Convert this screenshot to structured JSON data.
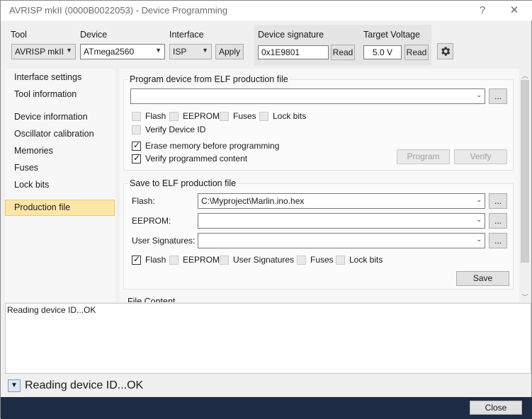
{
  "window": {
    "title": "AVRISP mkII (0000B0022053) - Device Programming",
    "help_glyph": "?",
    "close_glyph": "✕"
  },
  "toolbar": {
    "tool_label": "Tool",
    "tool_value": "AVRISP mkII",
    "device_label": "Device",
    "device_value": "ATmega2560",
    "interface_label": "Interface",
    "interface_value": "ISP",
    "apply_label": "Apply",
    "signature_label": "Device signature",
    "signature_value": "0x1E9801",
    "signature_read_label": "Read",
    "voltage_label": "Target Voltage",
    "voltage_value": "5.0 V",
    "voltage_read_label": "Read",
    "settings_icon": "gear-icon"
  },
  "sidebar": {
    "items": [
      {
        "label": "Interface settings"
      },
      {
        "label": "Tool information"
      },
      {
        "label": "Device information"
      },
      {
        "label": "Oscillator calibration"
      },
      {
        "label": "Memories"
      },
      {
        "label": "Fuses"
      },
      {
        "label": "Lock bits"
      },
      {
        "label": "Production file"
      }
    ],
    "active": "Production file"
  },
  "program_group": {
    "title": "Program device from ELF production file",
    "file_value": "",
    "browse_label": "...",
    "checks": {
      "flash": {
        "label": "Flash",
        "checked": false
      },
      "eeprom": {
        "label": "EEPROM",
        "checked": false
      },
      "fuses": {
        "label": "Fuses",
        "checked": false
      },
      "lockbits": {
        "label": "Lock bits",
        "checked": false
      },
      "verify_id": {
        "label": "Verify Device ID",
        "checked": false
      },
      "erase": {
        "label": "Erase memory before programming",
        "checked": true
      },
      "verify_content": {
        "label": "Verify programmed content",
        "checked": true
      }
    },
    "program_label": "Program",
    "verify_label": "Verify"
  },
  "save_group": {
    "title": "Save to ELF production file",
    "flash_label": "Flash:",
    "flash_value": "C:\\Myproject\\Marlin.ino.hex",
    "eeprom_label": "EEPROM:",
    "eeprom_value": "",
    "usersig_label": "User Signatures:",
    "usersig_value": "",
    "browse_label": "...",
    "checks": {
      "flash": {
        "label": "Flash",
        "checked": true
      },
      "eeprom": {
        "label": "EEPROM",
        "checked": false
      },
      "usersig": {
        "label": "User Signatures",
        "checked": false
      },
      "fuses": {
        "label": "Fuses",
        "checked": false
      },
      "lockbits": {
        "label": "Lock bits",
        "checked": false
      }
    },
    "save_label": "Save"
  },
  "file_content_label": "File Content",
  "log": {
    "text": "Reading device ID...OK"
  },
  "status": {
    "text": "Reading device ID...OK"
  },
  "footer": {
    "close_label": "Close"
  }
}
